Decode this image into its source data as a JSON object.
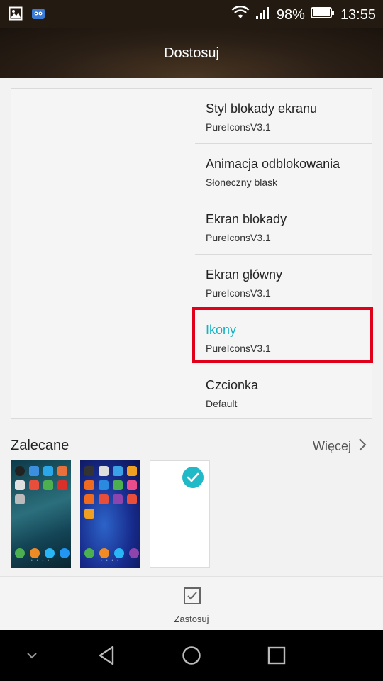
{
  "status_bar": {
    "battery": "98%",
    "time": "13:55",
    "icons": [
      "gallery-icon",
      "notification-app-icon",
      "wifi-icon",
      "signal-icon",
      "battery-icon"
    ]
  },
  "header": {
    "title": "Dostosuj"
  },
  "menu": {
    "items": [
      {
        "title": "Styl blokady ekranu",
        "value": "PureIconsV3.1"
      },
      {
        "title": "Animacja odblokowania",
        "value": "Słoneczny blask"
      },
      {
        "title": "Ekran blokady",
        "value": "PureIconsV3.1"
      },
      {
        "title": "Ekran główny",
        "value": "PureIconsV3.1"
      },
      {
        "title": "Ikony",
        "value": "PureIconsV3.1",
        "active": true
      },
      {
        "title": "Czcionka",
        "value": "Default"
      }
    ]
  },
  "recommended": {
    "title": "Zalecane",
    "more_label": "Więcej",
    "thumbnails": [
      "theme-thumbnail-1",
      "theme-thumbnail-2",
      "theme-thumbnail-selected"
    ],
    "selected_index": 2
  },
  "apply": {
    "label": "Zastosuj"
  },
  "navigation": [
    "chevron-down-icon",
    "back-icon",
    "home-icon",
    "recents-icon"
  ],
  "colors": {
    "accent": "#13b3c6",
    "highlight_border": "#e0001a",
    "check_badge": "#20b9c8",
    "header_bg": "#2a1f16"
  }
}
